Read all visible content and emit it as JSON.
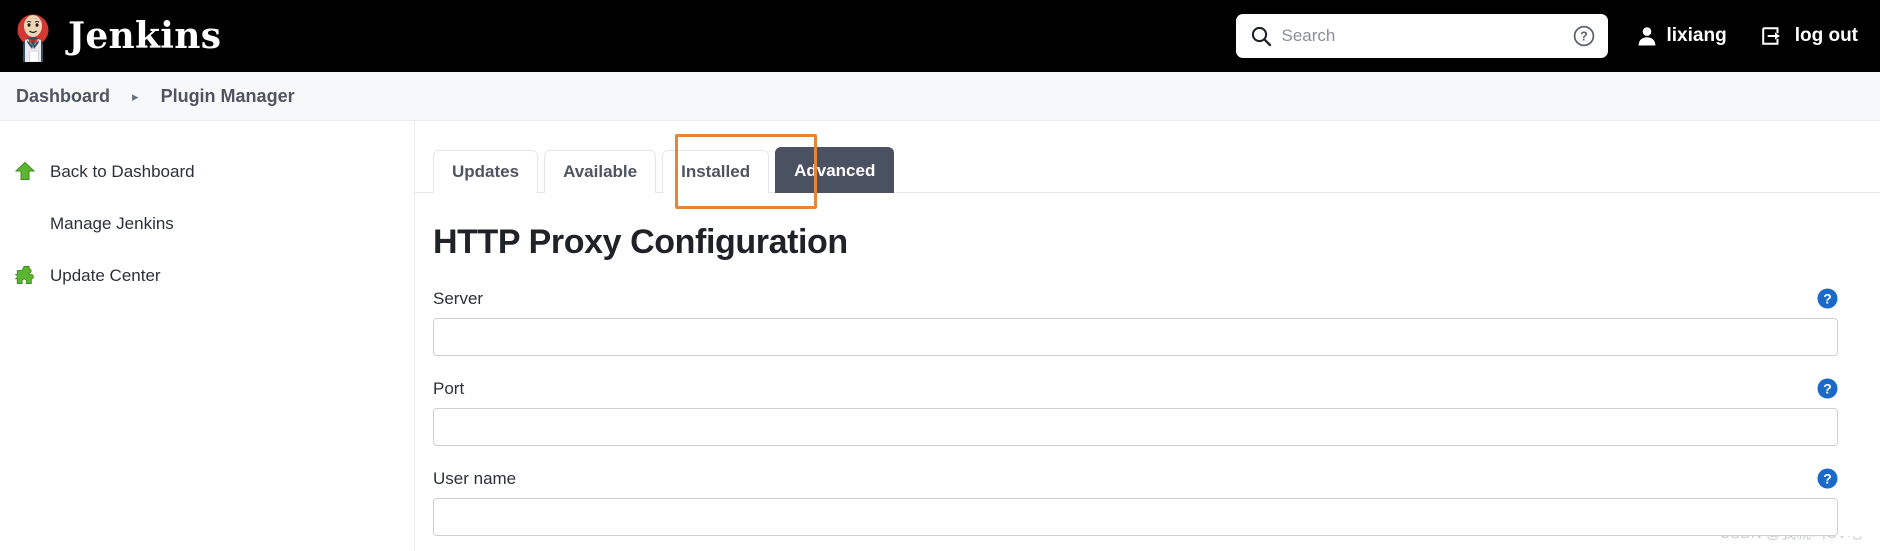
{
  "header": {
    "brand_title": "Jenkins",
    "brand_logo_icon": "jenkins-butler-logo",
    "search": {
      "placeholder": "Search",
      "value": "",
      "icon": "search-icon",
      "help_icon": "question-circle-icon"
    },
    "user": {
      "label": "lixiang",
      "icon": "person-icon"
    },
    "logout": {
      "label": "log out",
      "icon": "logout-arrow-icon"
    },
    "background_color": "#000000"
  },
  "breadcrumb": {
    "separator": "▸",
    "items": [
      {
        "label": "Dashboard"
      },
      {
        "label": "Plugin Manager"
      }
    ]
  },
  "sidebar": {
    "items": [
      {
        "label": "Back to Dashboard",
        "icon": "green-up-arrow-icon",
        "has_icon": true
      },
      {
        "label": "Manage Jenkins",
        "icon": "",
        "has_icon": false
      },
      {
        "label": "Update Center",
        "icon": "green-puzzle-piece-icon",
        "has_icon": true
      }
    ]
  },
  "main": {
    "tabs": [
      {
        "label": "Updates",
        "active": false
      },
      {
        "label": "Available",
        "active": false
      },
      {
        "label": "Installed",
        "active": false
      },
      {
        "label": "Advanced",
        "active": true
      }
    ],
    "panel_title": "HTTP Proxy Configuration",
    "fields": [
      {
        "label": "Server",
        "value": "",
        "placeholder": "",
        "help_icon": "blue-question-help-icon"
      },
      {
        "label": "Port",
        "value": "",
        "placeholder": "",
        "help_icon": "blue-question-help-icon"
      },
      {
        "label": "User name",
        "value": "",
        "placeholder": "",
        "help_icon": "blue-question-help-icon"
      }
    ]
  },
  "annotation": {
    "target_tab": "Advanced",
    "color": "#e4853c"
  },
  "watermark": {
    "text": "CSDN @我就叫CV吧"
  },
  "colors": {
    "header_bg": "#000000",
    "active_tab_bg": "#4a5161",
    "help_blue": "#1b6ac9",
    "sidebar_green": "#4caf2f",
    "annotation_orange": "#e4853c"
  }
}
